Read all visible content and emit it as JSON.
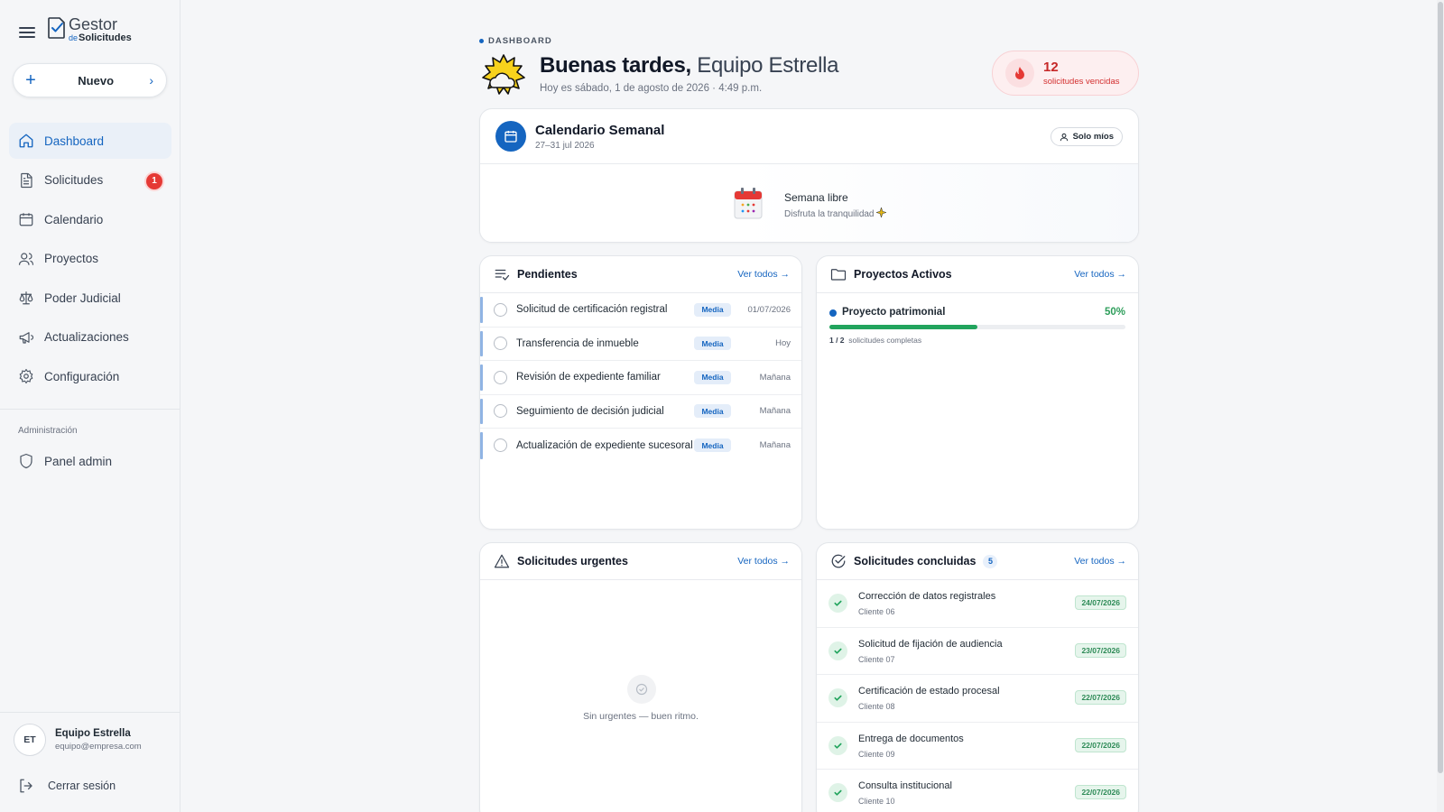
{
  "sidebar": {
    "logo": {
      "line1": "Gestor",
      "de": "de",
      "line2": "Solicitudes"
    },
    "new_button": "Nuevo",
    "items": [
      {
        "label": "Dashboard",
        "icon": "home-icon",
        "active": true
      },
      {
        "label": "Solicitudes",
        "icon": "file-icon",
        "badge": "1"
      },
      {
        "label": "Calendario",
        "icon": "calendar-icon"
      },
      {
        "label": "Proyectos",
        "icon": "users-icon"
      },
      {
        "label": "Poder Judicial",
        "icon": "scale-icon"
      },
      {
        "label": "Actualizaciones",
        "icon": "megaphone-icon"
      },
      {
        "label": "Configuración",
        "icon": "gear-icon"
      }
    ],
    "admin_title": "Administración",
    "admin_item": {
      "label": "Panel admin",
      "icon": "shield-icon"
    },
    "user": {
      "initials": "ET",
      "name": "Equipo Estrella",
      "email": "equipo@empresa.com"
    },
    "logout": "Cerrar sesión"
  },
  "header": {
    "breadcrumb": "DASHBOARD",
    "greeting": "Buenas tardes,",
    "team": "Equipo Estrella",
    "subline": "Hoy es sábado, 1 de agosto de 2026 · 4:49 p.m.",
    "overdue_count": "12",
    "overdue_label": "solicitudes vencidas"
  },
  "calendar": {
    "title": "Calendario Semanal",
    "range": "27–31 jul 2026",
    "filter": "Solo míos",
    "empty_title": "Semana libre",
    "empty_sub": "Disfruta la tranquilidad"
  },
  "pending": {
    "title": "Pendientes",
    "see_all": "Ver todos →",
    "rows": [
      {
        "name": "Solicitud de certificación registral",
        "priority": "Media",
        "date": "01/07/2026"
      },
      {
        "name": "Transferencia de inmueble",
        "priority": "Media",
        "date": "Hoy"
      },
      {
        "name": "Revisión de expediente familiar",
        "priority": "Media",
        "date": "Mañana"
      },
      {
        "name": "Seguimiento de decisión judicial",
        "priority": "Media",
        "date": "Mañana"
      },
      {
        "name": "Actualización de expediente sucesoral",
        "priority": "Media",
        "date": "Mañana"
      }
    ]
  },
  "projects": {
    "title": "Proyectos Activos",
    "see_all": "Ver todos →",
    "items": [
      {
        "name": "Proyecto patrimonial",
        "percent_label": "50%",
        "progress": 0.5,
        "done": "1 / 2",
        "done_label": "solicitudes completas"
      }
    ]
  },
  "urgent": {
    "title": "Solicitudes urgentes",
    "see_all": "Ver todos →",
    "empty": "Sin urgentes — buen ritmo."
  },
  "completed": {
    "title": "Solicitudes concluidas",
    "count": "5",
    "see_all": "Ver todos →",
    "rows": [
      {
        "name": "Corrección de datos registrales",
        "client": "Cliente 06",
        "date": "24/07/2026"
      },
      {
        "name": "Solicitud de fijación de audiencia",
        "client": "Cliente 07",
        "date": "23/07/2026"
      },
      {
        "name": "Certificación de estado procesal",
        "client": "Cliente 08",
        "date": "22/07/2026"
      },
      {
        "name": "Entrega de documentos",
        "client": "Cliente 09",
        "date": "22/07/2026"
      },
      {
        "name": "Consulta institucional",
        "client": "Cliente 10",
        "date": "22/07/2026"
      }
    ]
  },
  "colors": {
    "accent": "#1565c0",
    "danger": "#c62828",
    "success": "#22a45d"
  }
}
